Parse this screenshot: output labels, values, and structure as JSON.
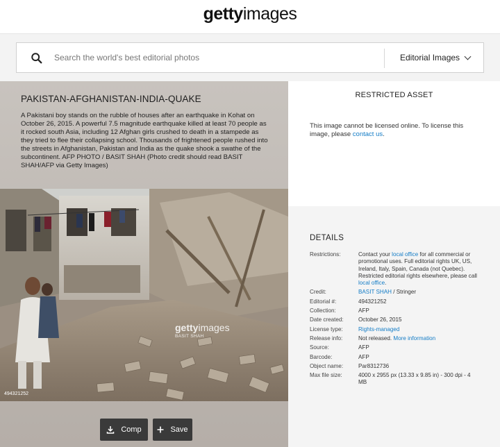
{
  "header": {
    "logo_bold": "getty",
    "logo_light": "images"
  },
  "search": {
    "placeholder": "Search the world's best editorial photos",
    "value": "",
    "type_label": "Editorial Images"
  },
  "image": {
    "headline": "PAKISTAN-AFGHANISTAN-INDIA-QUAKE",
    "caption": "A Pakistani boy stands on the rubble of houses after an earthquake in Kohat on October 26, 2015. A powerful 7.5 magnitude earthquake killed at least 70 people as it rocked south Asia, including 12 Afghan girls crushed to death in a stampede as they tried to flee their collapsing school. Thousands of frightened people rushed into the streets in Afghanistan, Pakistan and India as the quake shook a swathe of the subcontinent. AFP PHOTO / BASIT SHAH (Photo credit should read BASIT SHAH/AFP via Getty Images)",
    "id_overlay": "494321252",
    "watermark_bold": "getty",
    "watermark_light": "images",
    "watermark_credit": "BASIT SHAH"
  },
  "actions": {
    "comp_label": "Comp",
    "save_label": "Save"
  },
  "restricted": {
    "title": "RESTRICTED ASSET",
    "message": "This image cannot be licensed online. To license this image, please ",
    "link": "contact us",
    "end": "."
  },
  "details": {
    "title": "DETAILS",
    "restrictions_label": "Restrictions:",
    "restrictions_a": "Contact your ",
    "restrictions_link1": "local office",
    "restrictions_b": " for all commercial or promotional uses. Full editorial rights UK, US, Ireland, Italy, Spain, Canada (not Quebec). Restricted editorial rights elsewhere, please call ",
    "restrictions_link2": "local office",
    "restrictions_c": ".",
    "credit_label": "Credit:",
    "credit_link": "BASIT SHAH",
    "credit_rest": " / Stringer",
    "rows": [
      {
        "label": "Editorial #:",
        "value": "494321252"
      },
      {
        "label": "Collection:",
        "value": "AFP"
      },
      {
        "label": "Date created:",
        "value": "October 26, 2015"
      }
    ],
    "license_label": "License type:",
    "license_link": "Rights-managed",
    "release_label": "Release info:",
    "release_value": "Not released. ",
    "release_link": "More information",
    "rows2": [
      {
        "label": "Source:",
        "value": "AFP"
      },
      {
        "label": "Barcode:",
        "value": "AFP"
      },
      {
        "label": "Object name:",
        "value": "Par8312736"
      },
      {
        "label": "Max file size:",
        "value": "4000 x 2955 px (13.33 x 9.85 in) - 300 dpi - 4 MB"
      }
    ]
  }
}
